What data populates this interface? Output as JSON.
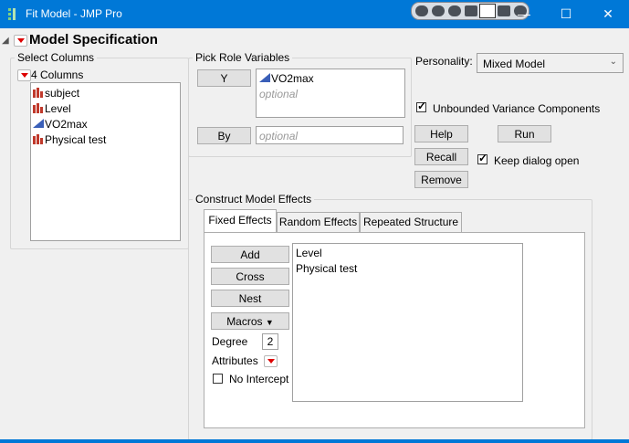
{
  "window": {
    "title": "Fit Model - JMP Pro",
    "minimize_icon": "—",
    "maximize_icon": "☐",
    "close_icon": "✕"
  },
  "outline": {
    "title": "Model Specification"
  },
  "select_columns": {
    "label": "Select Columns",
    "count_label": "4 Columns",
    "columns": [
      {
        "name": "subject",
        "type": "nominal"
      },
      {
        "name": "Level",
        "type": "nominal"
      },
      {
        "name": "VO2max",
        "type": "continuous"
      },
      {
        "name": "Physical test",
        "type": "nominal"
      }
    ]
  },
  "pick_roles": {
    "label": "Pick Role Variables",
    "y_button": "Y",
    "y_value": "VO2max",
    "y_optional": "optional",
    "by_button": "By",
    "by_placeholder": "optional"
  },
  "personality": {
    "label": "Personality:",
    "value": "Mixed Model"
  },
  "options": {
    "unbounded_label": "Unbounded Variance Components",
    "unbounded_checked": true,
    "keep_open_label": "Keep dialog open",
    "keep_open_checked": true
  },
  "actions": {
    "help": "Help",
    "run": "Run",
    "recall": "Recall",
    "remove": "Remove"
  },
  "construct": {
    "label": "Construct Model Effects",
    "tabs": [
      "Fixed Effects",
      "Random Effects",
      "Repeated Structure"
    ],
    "active_tab": "Fixed Effects",
    "add": "Add",
    "cross": "Cross",
    "nest": "Nest",
    "macros": "Macros",
    "degree_label": "Degree",
    "degree_value": "2",
    "attributes_label": "Attributes",
    "no_intercept_label": "No Intercept",
    "no_intercept_checked": false,
    "effects": [
      "Level",
      "Physical test"
    ]
  },
  "colors": {
    "titlebar": "#0078d7",
    "nominal_icon": "#c0392b",
    "continuous_icon": "#3a5fb8",
    "disclosure_red": "#dd0000"
  }
}
